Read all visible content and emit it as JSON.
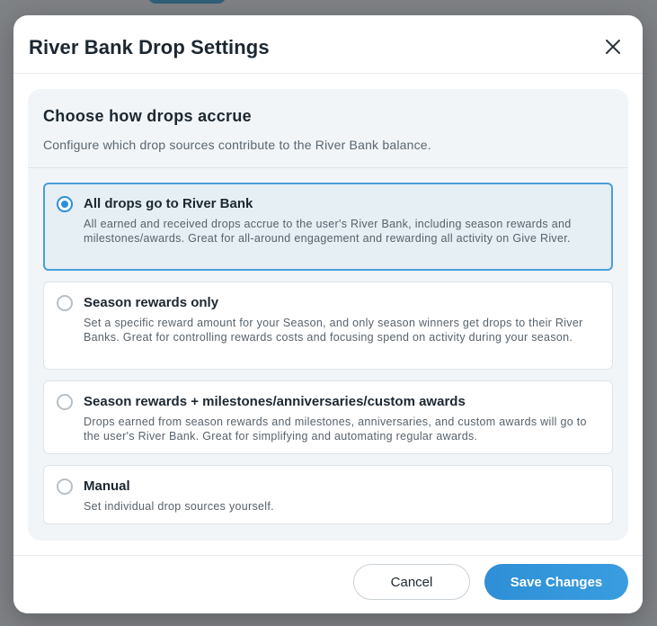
{
  "modal": {
    "title": "River Bank Drop Settings"
  },
  "card": {
    "title": "Choose how drops accrue",
    "subtitle": "Configure which drop sources contribute to the River Bank balance."
  },
  "options": [
    {
      "title": "All drops go to River Bank",
      "description": "All earned and received drops accrue to the user's River Bank, including season rewards and milestones/awards. Great for all-around engagement and rewarding all activity on Give River.",
      "selected": true
    },
    {
      "title": "Season rewards only",
      "description": "Set a specific reward amount for your Season, and only season winners get drops to their River Banks. Great for controlling rewards costs and focusing spend on activity during your season.",
      "selected": false
    },
    {
      "title": "Season rewards + milestones/anniversaries/custom awards",
      "description": "Drops earned from season rewards and milestones, anniversaries, and custom awards will go to the user's River Bank. Great for simplifying and automating regular awards.",
      "selected": false
    },
    {
      "title": "Manual",
      "description": "Set individual drop sources yourself.",
      "selected": false
    }
  ],
  "footer": {
    "cancel_label": "Cancel",
    "save_label": "Save Changes"
  },
  "colors": {
    "accent": "#2e8fd6",
    "selected_bg": "#e5eff4"
  },
  "icons": {
    "close": "close-icon"
  }
}
